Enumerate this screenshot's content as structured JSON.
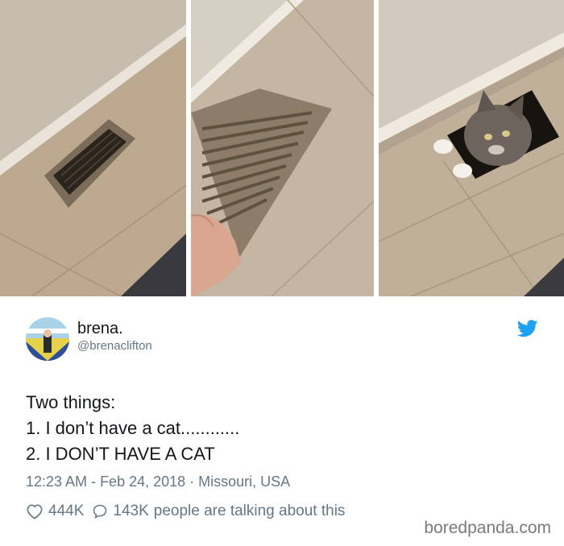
{
  "tweet": {
    "display_name": "brena.",
    "handle": "@brenaclifton",
    "text_lines": [
      "Two things:",
      "1. I don’t have a cat............",
      "2. I DON’T HAVE A CAT"
    ],
    "time": "12:23 AM",
    "date": "Feb 24, 2018",
    "separator_1": " - ",
    "separator_2": " · ",
    "location": "Missouri, USA",
    "likes": "444K",
    "replies": "143K",
    "talking_label": "people are talking about this"
  },
  "watermark": "boredpanda.com",
  "colors": {
    "text": "#14171a",
    "muted": "#657786",
    "twitter_blue": "#1da1f2"
  },
  "icons": [
    "twitter-bird-icon",
    "heart-icon",
    "reply-bubble-icon"
  ]
}
